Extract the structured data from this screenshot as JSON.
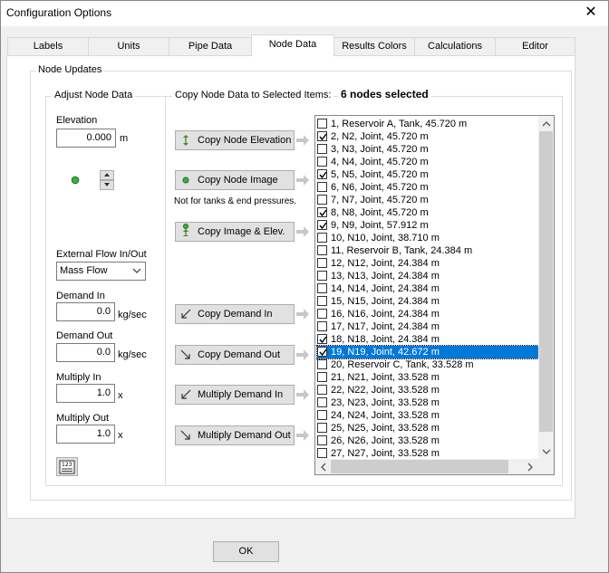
{
  "window": {
    "title": "Configuration Options",
    "close": "✕"
  },
  "tabs": [
    {
      "label": "Labels",
      "active": false
    },
    {
      "label": "Units",
      "active": false
    },
    {
      "label": "Pipe Data",
      "active": false
    },
    {
      "label": "Node Data",
      "active": true
    },
    {
      "label": "Results Colors",
      "active": false
    },
    {
      "label": "Calculations",
      "active": false
    },
    {
      "label": "Editor",
      "active": false
    }
  ],
  "node_updates": {
    "group_label": "Node Updates",
    "adjust": {
      "group_label": "Adjust Node Data",
      "elevation_label": "Elevation",
      "elevation_value": "0.000",
      "elevation_unit": "m",
      "external_flow_label": "External Flow In/Out",
      "external_flow_value": "Mass Flow",
      "demand_in_label": "Demand In",
      "demand_in_value": "0.0",
      "demand_in_unit": "kg/sec",
      "demand_out_label": "Demand Out",
      "demand_out_value": "0.0",
      "demand_out_unit": "kg/sec",
      "multiply_in_label": "Multiply In",
      "multiply_in_value": "1.0",
      "multiply_in_unit": "x",
      "multiply_out_label": "Multiply Out",
      "multiply_out_value": "1.0",
      "multiply_out_unit": "x",
      "calculator_icon_text": "123"
    },
    "copy": {
      "header_label": "Copy Node Data to Selected Items:",
      "selected_count": "6 nodes selected",
      "btn_copy_elevation": "Copy Node Elevation",
      "btn_copy_image": "Copy Node Image",
      "image_note": "Not for tanks & end pressures.",
      "btn_copy_image_elev": "Copy Image & Elev.",
      "btn_copy_demand_in": "Copy Demand In",
      "btn_copy_demand_out": "Copy Demand Out",
      "btn_multiply_in": "Multiply Demand In",
      "btn_multiply_out": "Multiply Demand Out"
    },
    "nodes": [
      {
        "text": "1, Reservoir A, Tank, 45.720 m",
        "checked": false,
        "selected": false
      },
      {
        "text": "2, N2, Joint, 45.720 m",
        "checked": true,
        "selected": false
      },
      {
        "text": "3, N3, Joint, 45.720 m",
        "checked": false,
        "selected": false
      },
      {
        "text": "4, N4, Joint, 45.720 m",
        "checked": false,
        "selected": false
      },
      {
        "text": "5, N5, Joint, 45.720 m",
        "checked": true,
        "selected": false
      },
      {
        "text": "6, N6, Joint, 45.720 m",
        "checked": false,
        "selected": false
      },
      {
        "text": "7, N7, Joint, 45.720 m",
        "checked": false,
        "selected": false
      },
      {
        "text": "8, N8, Joint, 45.720 m",
        "checked": true,
        "selected": false
      },
      {
        "text": "9, N9, Joint, 57.912 m",
        "checked": true,
        "selected": false
      },
      {
        "text": "10, N10, Joint, 38.710 m",
        "checked": false,
        "selected": false
      },
      {
        "text": "11, Reservoir B, Tank, 24.384 m",
        "checked": false,
        "selected": false
      },
      {
        "text": "12, N12, Joint, 24.384 m",
        "checked": false,
        "selected": false
      },
      {
        "text": "13, N13, Joint, 24.384 m",
        "checked": false,
        "selected": false
      },
      {
        "text": "14, N14, Joint, 24.384 m",
        "checked": false,
        "selected": false
      },
      {
        "text": "15, N15, Joint, 24.384 m",
        "checked": false,
        "selected": false
      },
      {
        "text": "16, N16, Joint, 24.384 m",
        "checked": false,
        "selected": false
      },
      {
        "text": "17, N17, Joint, 24.384 m",
        "checked": false,
        "selected": false
      },
      {
        "text": "18, N18, Joint, 24.384 m",
        "checked": true,
        "selected": false
      },
      {
        "text": "19, N19, Joint, 42.672 m",
        "checked": true,
        "selected": true
      },
      {
        "text": "20, Reservoir C, Tank, 33.528 m",
        "checked": false,
        "selected": false
      },
      {
        "text": "21, N21, Joint, 33.528 m",
        "checked": false,
        "selected": false
      },
      {
        "text": "22, N22, Joint, 33.528 m",
        "checked": false,
        "selected": false
      },
      {
        "text": "23, N23, Joint, 33.528 m",
        "checked": false,
        "selected": false
      },
      {
        "text": "24, N24, Joint, 33.528 m",
        "checked": false,
        "selected": false
      },
      {
        "text": "25, N25, Joint, 33.528 m",
        "checked": false,
        "selected": false
      },
      {
        "text": "26, N26, Joint, 33.528 m",
        "checked": false,
        "selected": false
      },
      {
        "text": "27, N27, Joint, 33.528 m",
        "checked": false,
        "selected": false
      }
    ]
  },
  "ok_label": "OK",
  "colors": {
    "selection": "#0078d7",
    "node_dot": "#3cb043",
    "icon_green": "#4a8a1a"
  }
}
